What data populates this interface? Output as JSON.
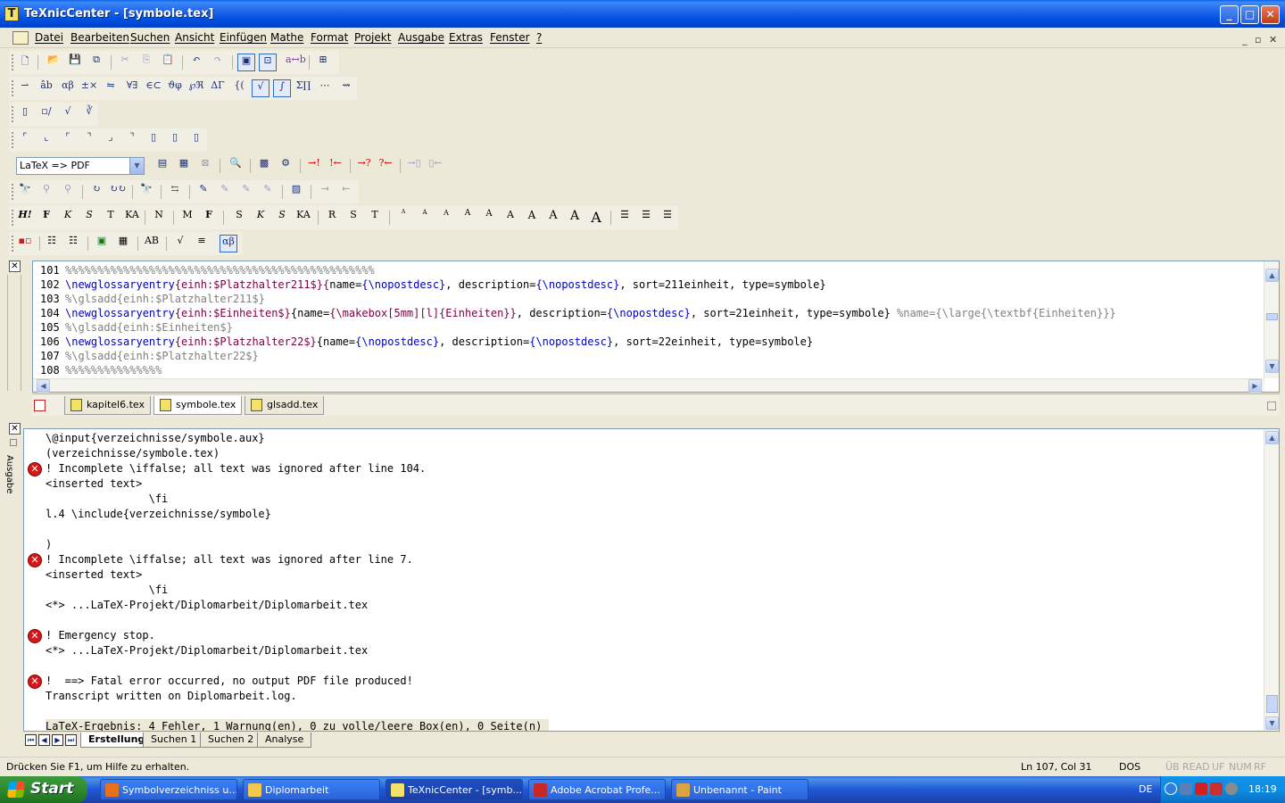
{
  "window": {
    "title": "TeXnicCenter - [symbole.tex]",
    "minimize": "_",
    "maximize": "□",
    "close": "✕"
  },
  "menu": [
    "Datei",
    "Bearbeiten",
    "Suchen",
    "Ansicht",
    "Einfügen",
    "Mathe",
    "Format",
    "Projekt",
    "Ausgabe",
    "Extras",
    "Fenster",
    "?"
  ],
  "mdi_controls": [
    "_",
    "▫",
    "✕"
  ],
  "toolbar": {
    "profile_select": "LaTeX => PDF"
  },
  "editor": {
    "lines": [
      {
        "num": "101",
        "parts": [
          {
            "t": "%%%%%%%%%%%%%%%%%%%%%%%%%%%%%%%%%%%%%%%%%%%%%%%%",
            "c": "cmt"
          }
        ]
      },
      {
        "num": "102",
        "parts": [
          {
            "t": "\\newglossaryentry",
            "c": "cmd"
          },
          {
            "t": "{einh:$Platzhalter211$}",
            "c": "grp"
          },
          {
            "t": "{",
            "c": "grp"
          },
          {
            "t": "name=",
            "c": "txt"
          },
          {
            "t": "{\\nopostdesc}",
            "c": "cmd"
          },
          {
            "t": ", description=",
            "c": "txt"
          },
          {
            "t": "{\\nopostdesc}",
            "c": "cmd"
          },
          {
            "t": ", sort=211einheit, type=symbole}",
            "c": "txt"
          }
        ]
      },
      {
        "num": "103",
        "parts": [
          {
            "t": "%\\glsadd{einh:$Platzhalter211$}",
            "c": "cmt"
          }
        ]
      },
      {
        "num": "104",
        "parts": [
          {
            "t": "\\newglossaryentry",
            "c": "cmd"
          },
          {
            "t": "{einh:$Einheiten$}",
            "c": "grp"
          },
          {
            "t": "{name=",
            "c": "txt"
          },
          {
            "t": "{\\makebox[5mm][l]{Einheiten}}",
            "c": "grp"
          },
          {
            "t": ", description=",
            "c": "txt"
          },
          {
            "t": "{\\nopostdesc}",
            "c": "cmd"
          },
          {
            "t": ", sort=21einheit, type=symbole} ",
            "c": "txt"
          },
          {
            "t": "%name={\\large{\\textbf{Einheiten}}}",
            "c": "cmt"
          }
        ]
      },
      {
        "num": "105",
        "parts": [
          {
            "t": "%\\glsadd{einh:$Einheiten$}",
            "c": "cmt"
          }
        ]
      },
      {
        "num": "106",
        "parts": [
          {
            "t": "\\newglossaryentry",
            "c": "cmd"
          },
          {
            "t": "{einh:$Platzhalter22$}",
            "c": "grp"
          },
          {
            "t": "{name=",
            "c": "txt"
          },
          {
            "t": "{\\nopostdesc}",
            "c": "cmd"
          },
          {
            "t": ", description=",
            "c": "txt"
          },
          {
            "t": "{\\nopostdesc}",
            "c": "cmd"
          },
          {
            "t": ", sort=22einheit, type=symbole}",
            "c": "txt"
          }
        ]
      },
      {
        "num": "107",
        "parts": [
          {
            "t": "%\\glsadd{einh:$Platzhalter22$}",
            "c": "cmt"
          }
        ]
      },
      {
        "num": "108",
        "parts": [
          {
            "t": "%%%%%%%%%%%%%%%",
            "c": "cmt"
          }
        ]
      }
    ]
  },
  "doc_tabs": [
    "kapitel6.tex",
    "symbole.tex",
    "glsadd.tex"
  ],
  "output": {
    "side_label": "Ausgabe",
    "lines": [
      {
        "text": "\\@input{verzeichnisse/symbole.aux}",
        "error": false
      },
      {
        "text": "(verzeichnisse/symbole.tex)",
        "error": false
      },
      {
        "text": "! Incomplete \\iffalse; all text was ignored after line 104.",
        "error": true
      },
      {
        "text": "<inserted text>",
        "error": false
      },
      {
        "text": "                \\fi",
        "error": false
      },
      {
        "text": "l.4 \\include{verzeichnisse/symbole}",
        "error": false
      },
      {
        "text": "",
        "error": false
      },
      {
        "text": ")",
        "error": false
      },
      {
        "text": "! Incomplete \\iffalse; all text was ignored after line 7.",
        "error": true
      },
      {
        "text": "<inserted text>",
        "error": false
      },
      {
        "text": "                \\fi",
        "error": false
      },
      {
        "text": "<*> ...LaTeX-Projekt/Diplomarbeit/Diplomarbeit.tex",
        "error": false
      },
      {
        "text": "",
        "error": false
      },
      {
        "text": "! Emergency stop.",
        "error": true
      },
      {
        "text": "<*> ...LaTeX-Projekt/Diplomarbeit/Diplomarbeit.tex",
        "error": false
      },
      {
        "text": "",
        "error": false
      },
      {
        "text": "!  ==> Fatal error occurred, no output PDF file produced!",
        "error": true
      },
      {
        "text": "Transcript written on Diplomarbeit.log.",
        "error": false
      },
      {
        "text": "",
        "error": false
      },
      {
        "text": "LaTeX-Ergebnis: 4 Fehler, 1 Warnung(en), 0 zu volle/leere Box(en), 0 Seite(n)",
        "error": false,
        "highlight": true
      }
    ],
    "tabs": [
      "Erstellung",
      "Suchen 1",
      "Suchen 2",
      "Analyse"
    ]
  },
  "status": {
    "help": "Drücken Sie F1, um Hilfe zu erhalten.",
    "position": "Ln 107, Col 31",
    "format": "DOS",
    "indicators": [
      "ÜB",
      "READ",
      "UF",
      "NUM",
      "RF"
    ]
  },
  "taskbar": {
    "start": "Start",
    "tasks": [
      {
        "label": "Symbolverzeichniss u...",
        "color": "#E8701A"
      },
      {
        "label": "Diplomarbeit",
        "color": "#F2C94C"
      },
      {
        "label": "TeXnicCenter - [symb...",
        "color": "#F3E26A"
      },
      {
        "label": "Adobe Acrobat Profe...",
        "color": "#C62828"
      },
      {
        "label": "Unbenannt - Paint",
        "color": "#D9A441"
      }
    ],
    "lang": "DE",
    "clock": "18:19"
  },
  "colors": {
    "error": "#D81818",
    "command": "#0000C0",
    "comment": "#808080",
    "selection_border": "#316AC5"
  }
}
